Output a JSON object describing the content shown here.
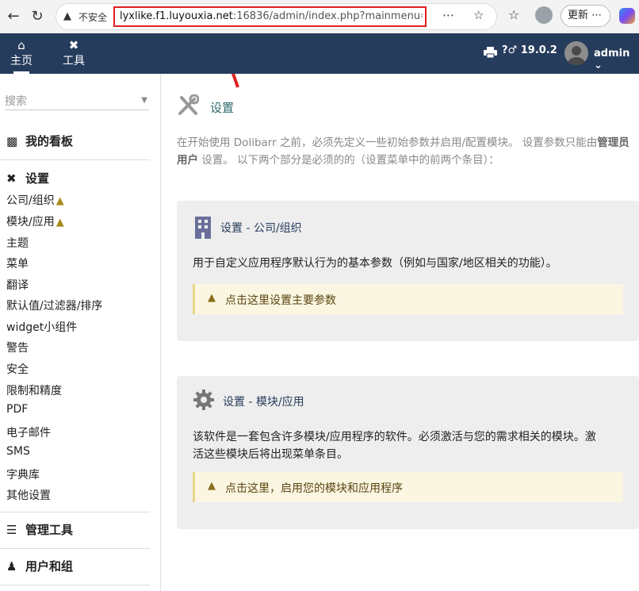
{
  "browser": {
    "insecure_label": "不安全",
    "url_host": "lyxlike.f1.luyouxia.net",
    "url_rest": ":16836/admin/index.php?mainmenu=ho...",
    "update_label": "更新"
  },
  "topbar": {
    "menus": [
      {
        "label": "主页",
        "icon": "home-icon"
      },
      {
        "label": "工具",
        "icon": "tools-icon"
      }
    ],
    "version": "19.0.2",
    "user": "admin"
  },
  "sidebar": {
    "search_placeholder": "搜索",
    "dashboard": "我的看板",
    "setup": "设置",
    "setup_items": [
      "公司/组织",
      "模块/应用",
      "主题",
      "菜单",
      "翻译",
      "默认值/过滤器/排序",
      "widget小组件",
      "警告",
      "安全",
      "限制和精度",
      "PDF",
      "电子邮件",
      "SMS",
      "字典库",
      "其他设置"
    ],
    "admin_tools": "管理工具",
    "users_groups": "用户和组"
  },
  "main": {
    "title": "设置",
    "intro_1": "在开始使用 Dolibarr 之前，必须先定义一些初始参数并启用/配置模块。 设置参数只能由",
    "intro_bold": "管理员用户",
    "intro_2": " 设置。 以下两个部分是必须的的（设置菜单中的前两个条目）：",
    "card1": {
      "title": "设置 - 公司/组织",
      "text": "用于自定义应用程序默认行为的基本参数（例如与国家/地区相关的功能）。",
      "notice": "点击这里设置主要参数"
    },
    "card2": {
      "title": "设置 - 模块/应用",
      "text_1": "该软件是一套包含许多模块/应用程序的软件。必须激活与您的需求相关的模块。激",
      "text_2": "活这些模块后将出现菜单条目。",
      "notice": "点击这里，启用您的模块和应用程序"
    }
  },
  "colors": {
    "topbar": "#263c5c",
    "title_teal": "#2f6b6b",
    "url_highlight": "#e02020",
    "warning": "#a88a1c"
  }
}
